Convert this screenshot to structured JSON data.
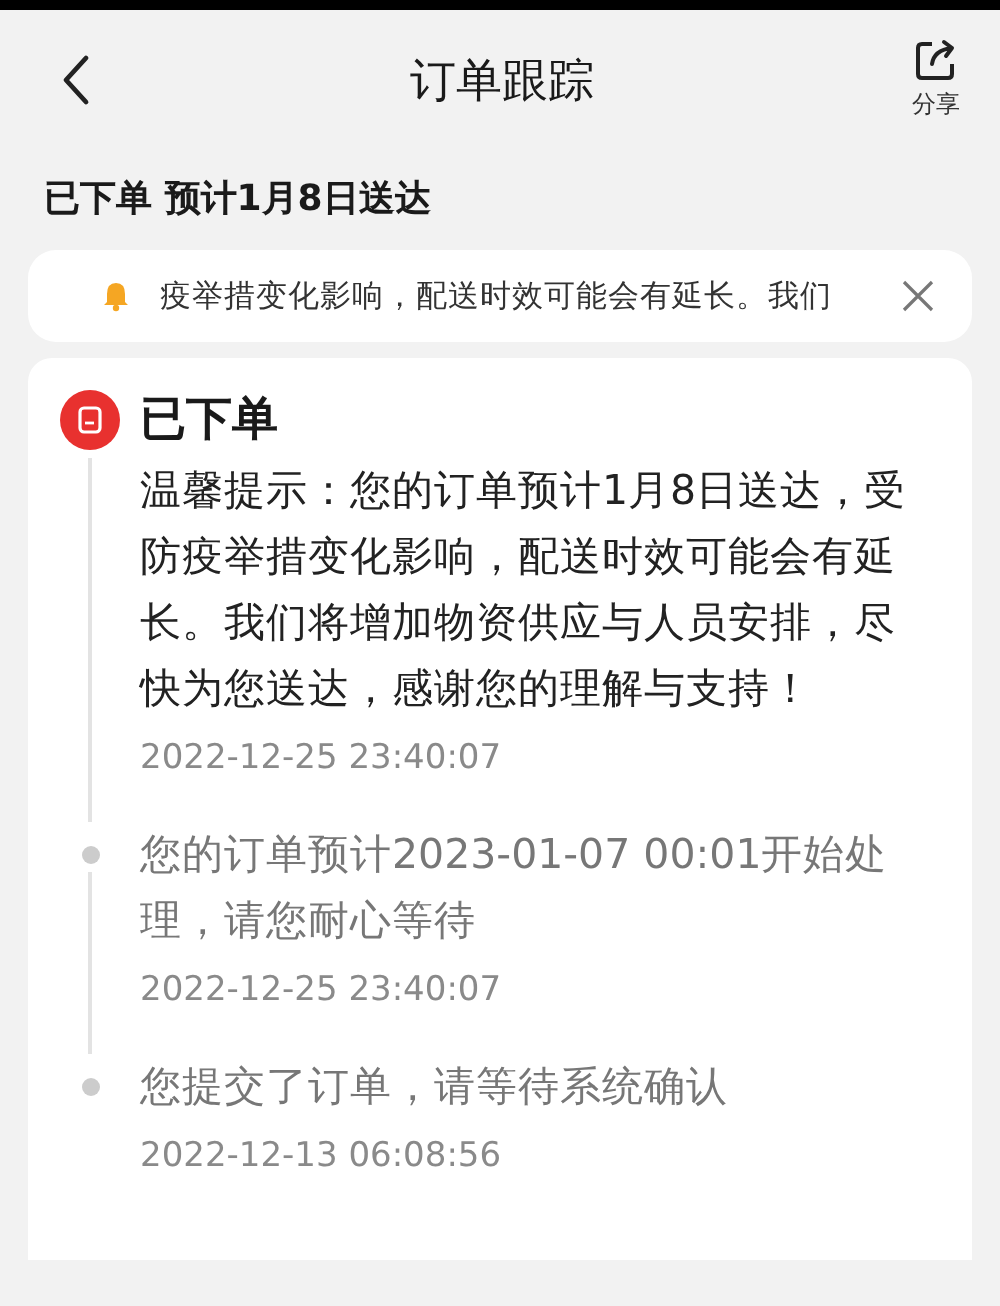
{
  "header": {
    "title": "订单跟踪",
    "share_label": "分享"
  },
  "summary": "已下单 预计1月8日送达",
  "notice": {
    "text": "疫举措变化影响，配送时效可能会有延长。我们"
  },
  "timeline": [
    {
      "kind": "headline",
      "title": "已下单",
      "text": "温馨提示：您的订单预计1月8日送达，受防疫举措变化影响，配送时效可能会有延长。我们将增加物资供应与人员安排，尽快为您送达，感谢您的理解与支持！",
      "time": "2022-12-25 23:40:07"
    },
    {
      "kind": "event",
      "text": "您的订单预计2023-01-07 00:01开始处理，请您耐心等待",
      "time": "2022-12-25 23:40:07"
    },
    {
      "kind": "event",
      "text": "您提交了订单，请等待系统确认",
      "time": "2022-12-13 06:08:56"
    }
  ]
}
